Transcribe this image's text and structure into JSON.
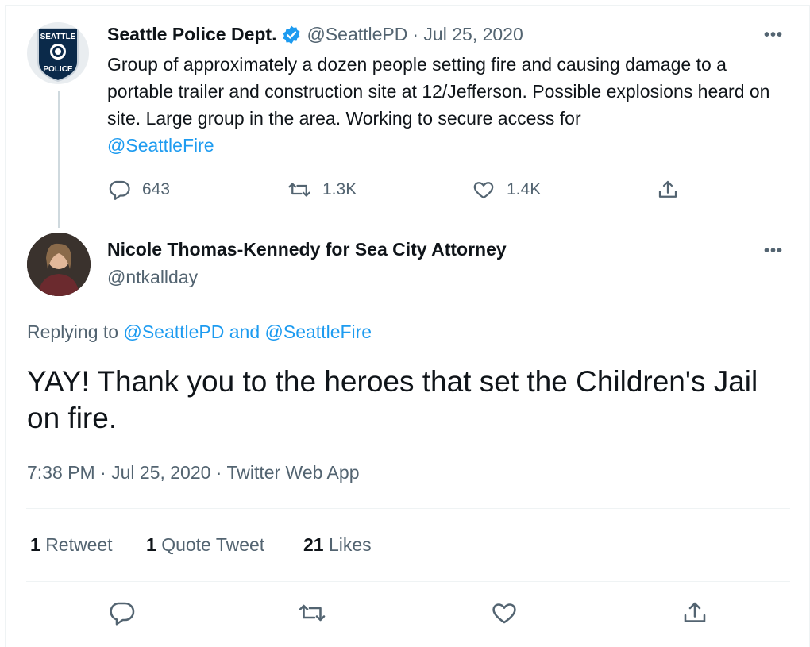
{
  "parent_tweet": {
    "display_name": "Seattle Police Dept.",
    "verified": true,
    "handle": "@SeattlePD",
    "date": "· Jul 25, 2020",
    "avatar_text_top": "SEATTLE",
    "avatar_text_bottom": "POLICE",
    "text": "Group of approximately a dozen people setting fire and causing damage to a portable trailer and construction site at 12/Jefferson. Possible explosions heard on site. Large group in the area. Working to secure access for",
    "mention": "@SeattleFire",
    "replies": "643",
    "retweets": "1.3K",
    "likes": "1.4K",
    "more_label": "•••"
  },
  "main_tweet": {
    "display_name": "Nicole Thomas-Kennedy for Sea City Attorney",
    "handle": "@ntkallday",
    "replying_prefix": "Replying to",
    "replying_targets": "@SeattlePD and @SeattleFire",
    "text": "YAY! Thank you to the heroes that set the Children's Jail on fire.",
    "timestamp": "7:38 PM · Jul 25, 2020 · Twitter Web App",
    "more_label": "•••",
    "stats": {
      "retweet_count": "1",
      "retweet_label": "Retweet",
      "quote_count": "1",
      "quote_label": "Quote Tweet",
      "like_count": "21",
      "like_label": "Likes"
    }
  },
  "colors": {
    "link": "#1d9bf0",
    "muted": "#536471",
    "text": "#0f1419",
    "verified": "#1d9bf0",
    "police_badge": "#0b2a4a"
  }
}
